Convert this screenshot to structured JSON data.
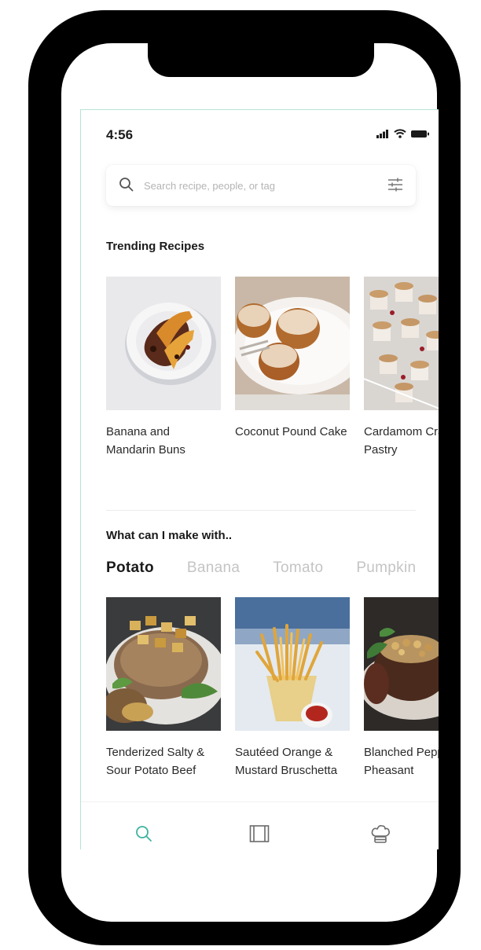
{
  "status_bar": {
    "time": "4:56"
  },
  "search": {
    "placeholder": "Search recipe, people, or tag"
  },
  "trending": {
    "title": "Trending Recipes",
    "recipes": [
      {
        "title": "Banana and Mandarin Buns"
      },
      {
        "title": "Coconut Pound Cake"
      },
      {
        "title": "Cardamom Cranberry Pastry"
      }
    ]
  },
  "make_with": {
    "title": "What can I make with..",
    "tabs": [
      {
        "label": "Potato",
        "active": true
      },
      {
        "label": "Banana",
        "active": false
      },
      {
        "label": "Tomato",
        "active": false
      },
      {
        "label": "Pumpkin",
        "active": false
      }
    ],
    "recipes": [
      {
        "title": "Tenderized Salty & Sour Potato Beef"
      },
      {
        "title": "Sautéed Orange & Mustard Bruschetta"
      },
      {
        "title": "Blanched Peppermint Pheasant"
      }
    ]
  },
  "bottom_nav": {
    "items": [
      {
        "icon": "search-icon",
        "active": true
      },
      {
        "icon": "book-icon",
        "active": false
      },
      {
        "icon": "chef-hat-icon",
        "active": false
      }
    ]
  },
  "colors": {
    "accent": "#3db39e",
    "inactive_icon": "#6b6b6b",
    "tab_inactive": "#c4c4c4"
  }
}
